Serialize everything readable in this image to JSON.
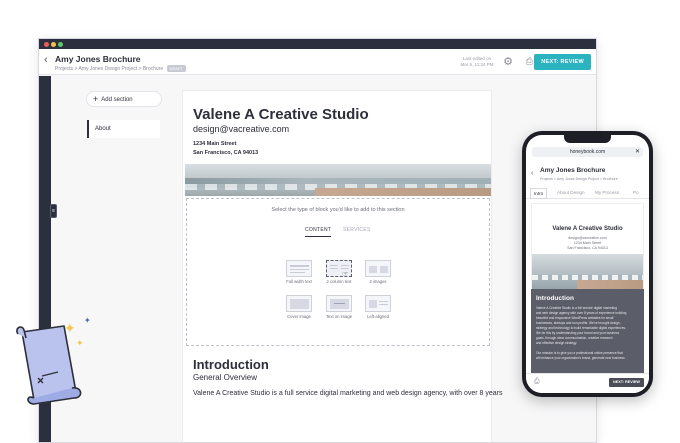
{
  "desktop": {
    "header": {
      "title": "Amy Jones Brochure",
      "breadcrumb": "Projects > Amy Jones Design Project > Brochure",
      "status_badge": "DRAFT",
      "saved_line1": "Last edited on",
      "saved_line2": "Mar 6, 11:24 PM",
      "next_button": "NEXT: REVIEW"
    },
    "sidebar": {
      "add_section": "Add section",
      "items": [
        {
          "label": "About"
        }
      ]
    },
    "document": {
      "studio_name": "Valene A Creative Studio",
      "email": "design@vacreative.com",
      "address_line1": "1234 Main Street",
      "address_line2": "San Francisco, CA 94013",
      "block_picker": {
        "prompt": "Select the type of block you'd like to add to this section",
        "tabs": [
          "CONTENT",
          "SERVICES"
        ],
        "options": [
          {
            "label": "Full width text"
          },
          {
            "label": "2 column text"
          },
          {
            "label": "2 images"
          },
          {
            "label": "Cover image"
          },
          {
            "label": "Text on image"
          },
          {
            "label": "Left-aligned"
          }
        ]
      },
      "intro_heading": "Introduction",
      "intro_subheading": "General Overview",
      "intro_body": "Valene A Creative Studio is a full service digital marketing and web design agency, with over 8 years"
    }
  },
  "mobile": {
    "url": "honeybook.com",
    "title": "Amy Jones Brochure",
    "breadcrumb": "Projects > Amy Jones Design Project > Brochure",
    "tabs": [
      "Intro",
      "About Design",
      "My Process",
      "Po"
    ],
    "studio_name": "Valene A Creative Studio",
    "email": "design@vacreative.com",
    "address_line1": "1234 Main Street",
    "address_line2": "San Francisco, CA 94013",
    "intro_heading": "Introduction",
    "intro_lines": [
      "Valene A Creative Studio is a full service digital marketing",
      "and web design agency with over 8 years of experience building",
      "beautiful and responsive WordPress websites for small",
      "businesses, startups and non-profits. We've brought design,",
      "strategy and technology to build remarkable digital experiences.",
      "We do this by understanding your brand and your business",
      "goals, through clear communication, creative research",
      "and effective design strategy.",
      "",
      "Our mission is to give you a professional online presence that",
      "will enhance your organization's brand, generate new business"
    ],
    "next_button": "NEXT: REVIEW"
  }
}
